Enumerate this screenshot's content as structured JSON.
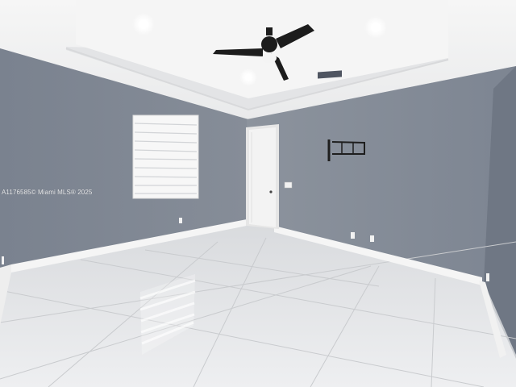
{
  "scene": {
    "description_name": "empty-room-photo",
    "watermark": "A1176585© Miami MLS® 2025",
    "colors": {
      "wall": "#7e8693",
      "ceiling": "#f3f3f3",
      "floor": "#e6e7e9",
      "baseboard": "#f5f5f5",
      "door": "#f2f2f2",
      "fan": "#1c1c1c"
    },
    "objects": [
      "ceiling-fan",
      "window-with-blinds",
      "interior-door",
      "tv-wall-mount",
      "recessed-lights",
      "air-vent",
      "electrical-outlets",
      "light-switch"
    ]
  }
}
